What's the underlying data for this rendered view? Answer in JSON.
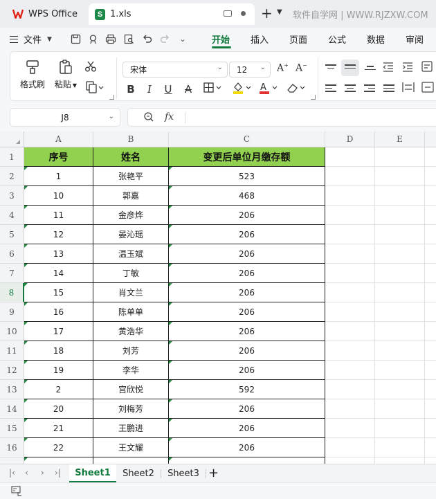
{
  "titlebar": {
    "app_tab": "WPS Office",
    "file_tab": "1.xls",
    "file_badge": "S",
    "watermark": "软件自学网 | WWW.RJZXW.COM"
  },
  "menubar": {
    "file_menu": "文件",
    "tabs": [
      {
        "label": "开始",
        "active": true
      },
      {
        "label": "插入",
        "active": false
      },
      {
        "label": "页面",
        "active": false
      },
      {
        "label": "公式",
        "active": false
      },
      {
        "label": "数据",
        "active": false
      },
      {
        "label": "审阅",
        "active": false
      }
    ]
  },
  "ribbon": {
    "format_painter": "格式刷",
    "paste": "粘贴",
    "font_name": "宋体",
    "font_size": "12",
    "colors": {
      "highlight": "#f5d800",
      "font_color": "#e03030"
    }
  },
  "formula_bar": {
    "name_box": "J8",
    "fx": "fx"
  },
  "sheet": {
    "columns": [
      "A",
      "B",
      "C",
      "D",
      "E"
    ],
    "rows": [
      "1",
      "2",
      "3",
      "4",
      "5",
      "6",
      "7",
      "8",
      "9",
      "10",
      "11",
      "12",
      "13",
      "14",
      "15",
      "16"
    ],
    "selected_row": "8",
    "header": [
      "序号",
      "姓名",
      "变更后单位月缴存额"
    ],
    "data": [
      [
        "1",
        "张艳平",
        "523"
      ],
      [
        "10",
        "郭嘉",
        "468"
      ],
      [
        "11",
        "金彦烨",
        "206"
      ],
      [
        "12",
        "晏沁瑶",
        "206"
      ],
      [
        "13",
        "温玉斌",
        "206"
      ],
      [
        "14",
        "丁敏",
        "206"
      ],
      [
        "15",
        "肖文兰",
        "206"
      ],
      [
        "16",
        "陈单单",
        "206"
      ],
      [
        "17",
        "黄浩华",
        "206"
      ],
      [
        "18",
        "刘芳",
        "206"
      ],
      [
        "19",
        "李华",
        "206"
      ],
      [
        "2",
        "宫欣悦",
        "592"
      ],
      [
        "20",
        "刘梅芳",
        "206"
      ],
      [
        "21",
        "王鹏进",
        "206"
      ],
      [
        "22",
        "王文耀",
        "206"
      ]
    ],
    "header_color": "#92d050"
  },
  "sheet_tabs": [
    {
      "label": "Sheet1",
      "active": true
    },
    {
      "label": "Sheet2",
      "active": false
    },
    {
      "label": "Sheet3",
      "active": false
    }
  ]
}
